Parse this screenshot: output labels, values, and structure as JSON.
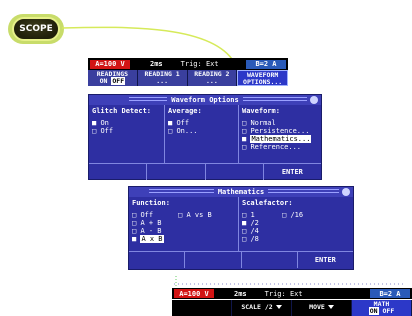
{
  "scope": {
    "label": "SCOPE"
  },
  "panel1": {
    "status": {
      "a": "A=100 V",
      "timebase": "2ms",
      "trig": "Trig: Ext",
      "b": "B=2 A"
    },
    "softkeys": [
      {
        "line1": "READINGS",
        "line2a": "ON",
        "line2b": "OFF"
      },
      {
        "line1": "READING 1",
        "line2": "..."
      },
      {
        "line1": "READING 2",
        "line2": "..."
      },
      {
        "line1": "WAVEFORM",
        "line2": "OPTIONS..."
      }
    ]
  },
  "waveform_options": {
    "title": "Waveform Options",
    "glitch_detect": {
      "header": "Glitch Detect:",
      "options": [
        "On",
        "Off"
      ],
      "selected": "On"
    },
    "average": {
      "header": "Average:",
      "options": [
        "Off",
        "On..."
      ],
      "selected": "Off"
    },
    "waveform": {
      "header": "Waveform:",
      "options": [
        "Normal",
        "Persistence...",
        "Mathematics...",
        "Reference..."
      ],
      "selected": "Mathematics..."
    },
    "bottom": {
      "enter": "ENTER"
    }
  },
  "mathematics": {
    "title": "Mathematics",
    "function": {
      "header": "Function:",
      "col1": [
        "Off",
        "A + B",
        "A - B",
        "A x B"
      ],
      "col2": [
        "A vs B"
      ],
      "selected": "A x B"
    },
    "scalefactor": {
      "header": "Scalefactor:",
      "col1": [
        "1",
        "/2",
        "/4",
        "/8"
      ],
      "col2": [
        "/16"
      ],
      "selected": "/2"
    },
    "bottom": {
      "enter": "ENTER"
    }
  },
  "panel3": {
    "status": {
      "a": "A=100 V",
      "timebase": "2ms",
      "trig": "Trig: Ext",
      "b": "B=2 A"
    },
    "softkeys": [
      {
        "label": ""
      },
      {
        "label": "SCALE /2"
      },
      {
        "label": "MOVE"
      },
      {
        "line1": "MATH",
        "line2a": "ON",
        "line2b": "OFF"
      }
    ]
  },
  "colors": {
    "panel_blue": "#2e2fa2",
    "channel_a": "#d21414",
    "channel_b": "#2a5ab8",
    "scope_green": "#c8dc6a"
  }
}
